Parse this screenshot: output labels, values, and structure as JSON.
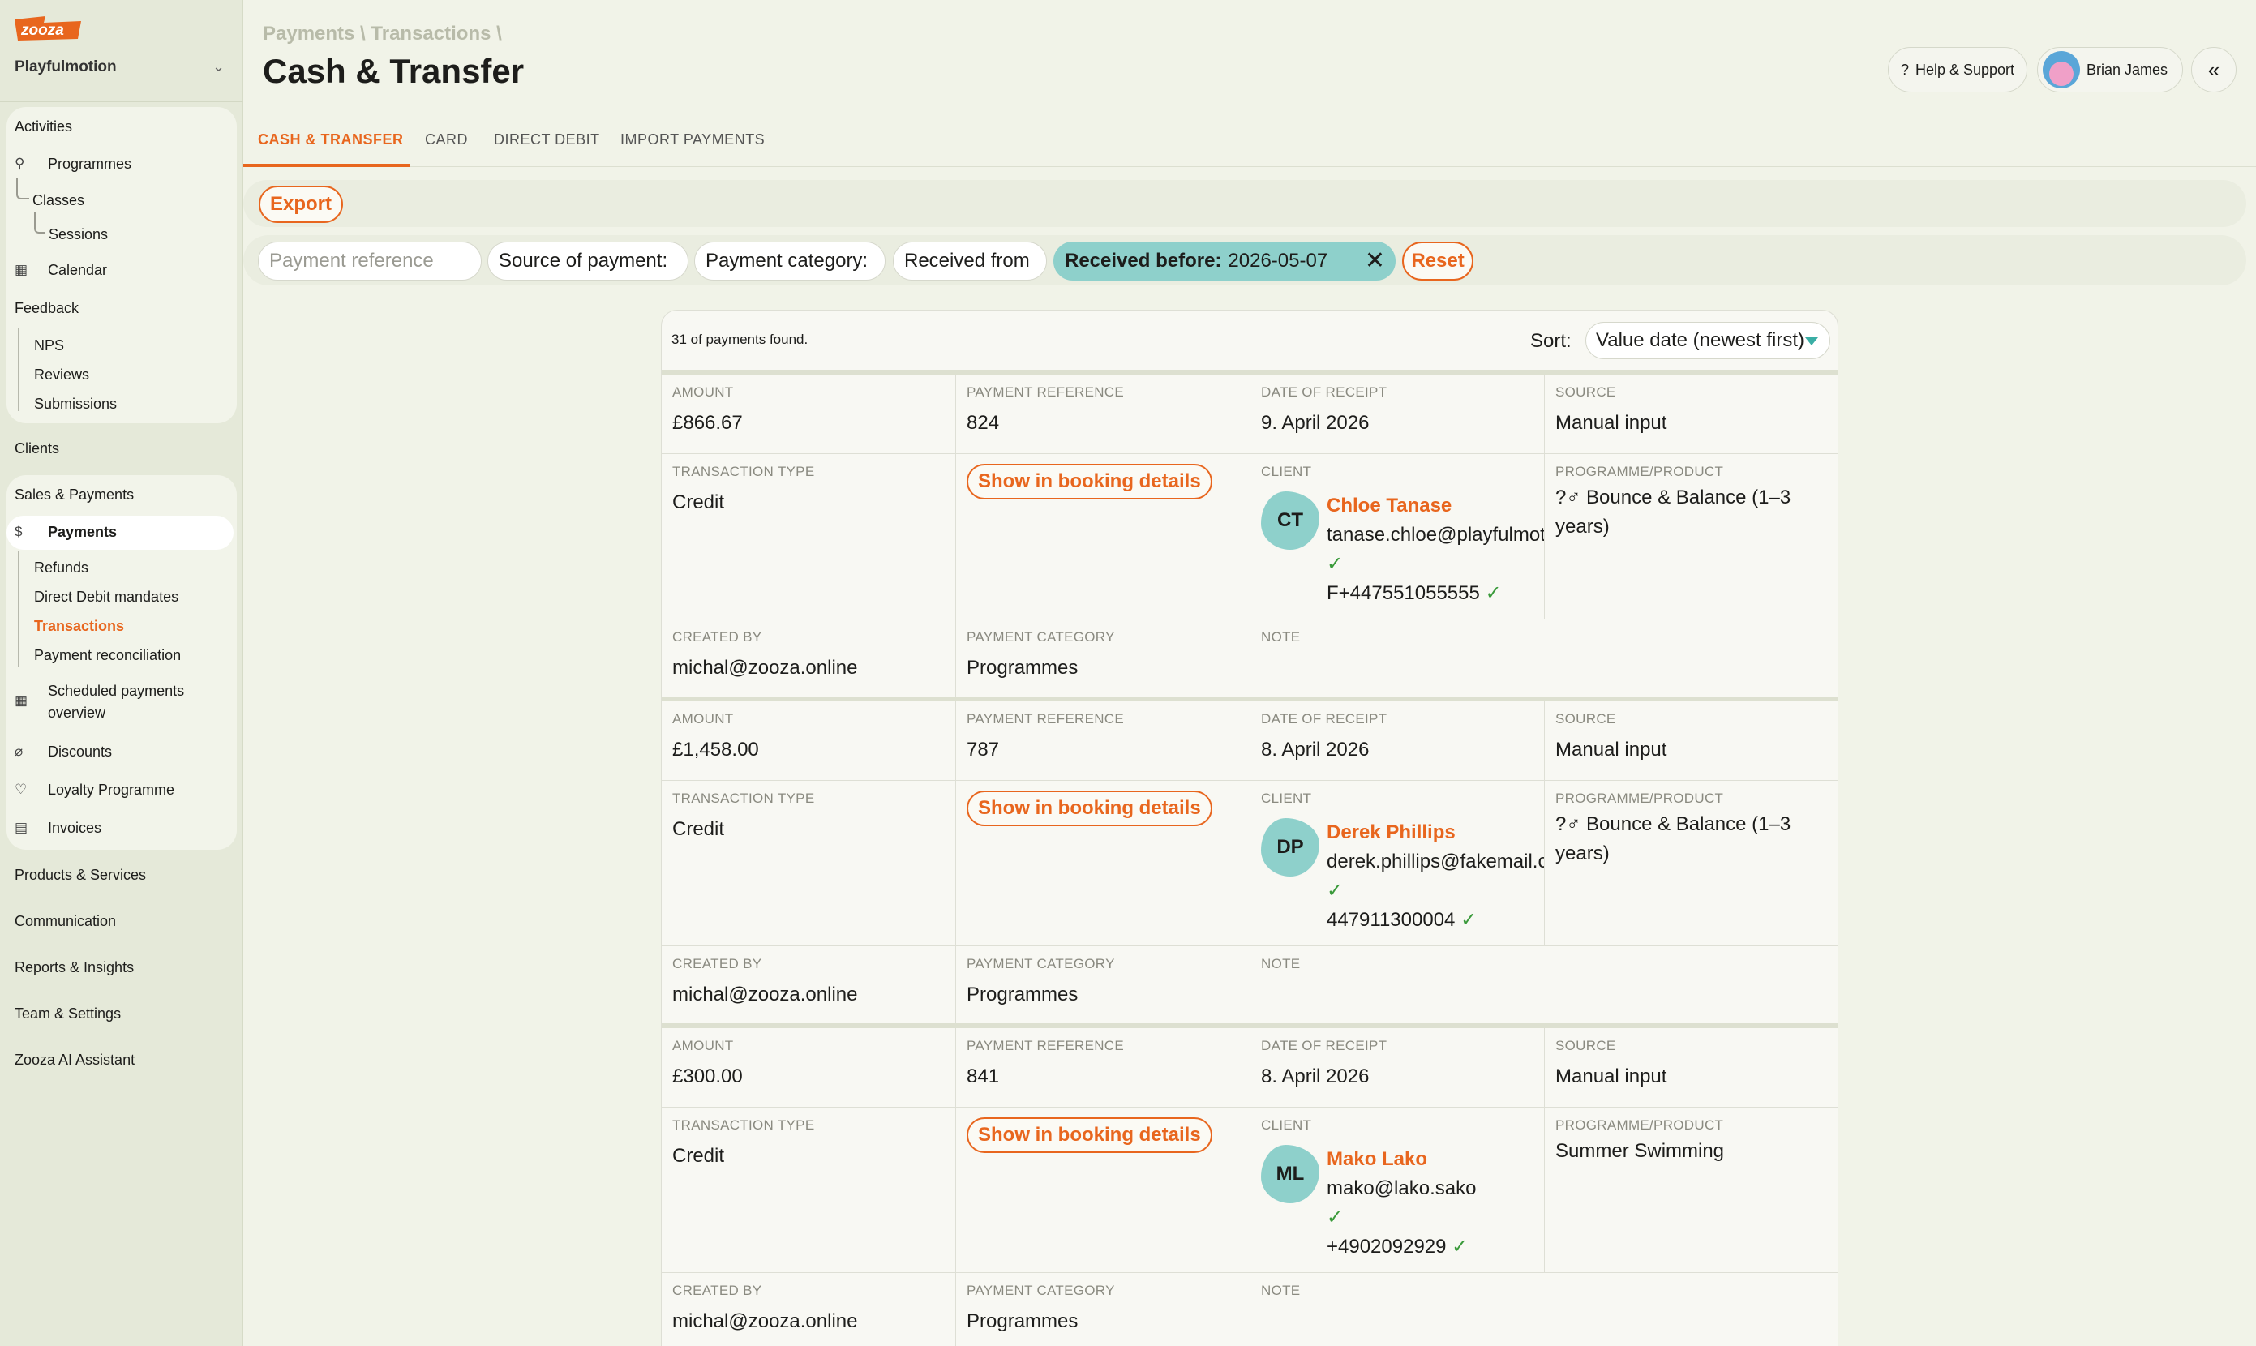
{
  "app": {
    "logo": "zooza",
    "org": "Playfulmotion"
  },
  "sidebar": {
    "activities": "Activities",
    "programmes": "Programmes",
    "classes": "Classes",
    "sessions": "Sessions",
    "calendar": "Calendar",
    "feedback": "Feedback",
    "nps": "NPS",
    "reviews": "Reviews",
    "submissions": "Submissions",
    "clients": "Clients",
    "sales": "Sales & Payments",
    "payments": "Payments",
    "refunds": "Refunds",
    "dd_mandates": "Direct Debit mandates",
    "transactions": "Transactions",
    "reconciliation": "Payment reconciliation",
    "scheduled_1": "Scheduled payments",
    "scheduled_2": "overview",
    "discounts": "Discounts",
    "loyalty": "Loyalty Programme",
    "invoices": "Invoices",
    "products": "Products & Services",
    "communication": "Communication",
    "reports": "Reports & Insights",
    "team": "Team & Settings",
    "ai": "Zooza AI Assistant"
  },
  "header": {
    "breadcrumb": "Payments \\ Transactions \\",
    "title": "Cash & Transfer",
    "help": "Help & Support",
    "user": "Brian James"
  },
  "tabs": [
    "CASH & TRANSFER",
    "CARD",
    "DIRECT DEBIT",
    "IMPORT PAYMENTS"
  ],
  "toolbar": {
    "export": "Export"
  },
  "filters": {
    "payment_reference": "Payment reference",
    "source": "Source of payment:",
    "category": "Payment category:",
    "received_from": "Received from",
    "received_before_label": "Received before:",
    "received_before_value": "2026-05-07",
    "reset": "Reset"
  },
  "results": {
    "count_text": "31 of payments found.",
    "sort_label": "Sort:",
    "sort_value": "Value date (newest first)"
  },
  "labels": {
    "amount": "AMOUNT",
    "payment_reference": "PAYMENT REFERENCE",
    "date_of_receipt": "DATE OF RECEIPT",
    "source": "SOURCE",
    "transaction_type": "TRANSACTION TYPE",
    "client": "CLIENT",
    "programme": "PROGRAMME/PRODUCT",
    "created_by": "CREATED BY",
    "payment_category": "PAYMENT CATEGORY",
    "note": "NOTE",
    "show_booking": "Show in booking details"
  },
  "payments": [
    {
      "amount": "£866.67",
      "reference": "824",
      "date": "9. April 2026",
      "source": "Manual input",
      "type": "Credit",
      "initials": "CT",
      "client_name": "Chloe Tanase",
      "email": "tanase.chloe@playfulmotion.co.uk",
      "phone": "F+447551055555",
      "programme": "?♂ Bounce & Balance (1–3 years)",
      "created_by": "michal@zooza.online",
      "category": "Programmes",
      "note": ""
    },
    {
      "amount": "£1,458.00",
      "reference": "787",
      "date": "8. April 2026",
      "source": "Manual input",
      "type": "Credit",
      "initials": "DP",
      "client_name": "Derek Phillips",
      "email": "derek.phillips@fakemail.com",
      "phone": "447911300004",
      "programme": "?♂ Bounce & Balance (1–3 years)",
      "created_by": "michal@zooza.online",
      "category": "Programmes",
      "note": ""
    },
    {
      "amount": "£300.00",
      "reference": "841",
      "date": "8. April 2026",
      "source": "Manual input",
      "type": "Credit",
      "initials": "ML",
      "client_name": "Mako Lako",
      "email": "mako@lako.sako",
      "phone": "+4902092929",
      "programme": "Summer Swimming",
      "created_by": "michal@zooza.online",
      "category": "Programmes",
      "note": ""
    }
  ],
  "colors": {
    "accent": "#e8661e",
    "teal": "#8ed0cb",
    "bg": "#f1f3e8"
  }
}
